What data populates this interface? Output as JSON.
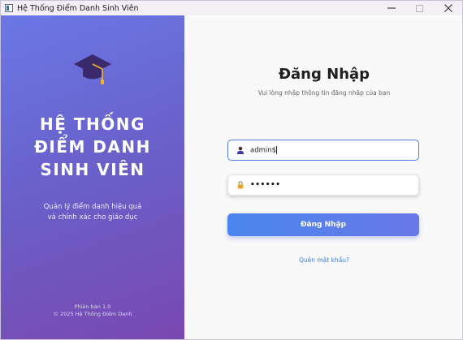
{
  "window": {
    "title": "Hệ Thống Điểm Danh Sinh Viên",
    "controls": [
      "minimize-icon",
      "maximize-icon",
      "close-icon"
    ]
  },
  "brand": {
    "icon": "graduation-cap-icon",
    "title_lines": [
      "HỆ THỐNG",
      "ĐIỂM DANH",
      "SINH VIÊN"
    ],
    "subtitle_lines": [
      "Quản lý điểm danh hiệu quả",
      "và chính xác cho giáo dục"
    ],
    "footer_lines": [
      "Phiên bản 1.0",
      "© 2025 Hệ Thống Điểm Danh"
    ]
  },
  "login": {
    "title": "Đăng Nhập",
    "subtitle": "Vui lòng nhập thông tin đăng nhập của bạn",
    "username_icon": "user-icon",
    "username_value": "admin$",
    "password_icon": "lock-icon",
    "password_masked": "••••••",
    "submit_label": "Đăng Nhập",
    "forgot_label": "Quên mật khẩu?"
  },
  "colors": {
    "panel_gradient_start": "#6a78e6",
    "panel_gradient_end": "#7948b0",
    "button_start": "#4a86ef",
    "button_end": "#6878e6",
    "input_focus_border": "#4a7fd6",
    "link": "#3f7fd6",
    "cap_body": "#3b2a6b",
    "cap_tassel": "#f0b429"
  }
}
